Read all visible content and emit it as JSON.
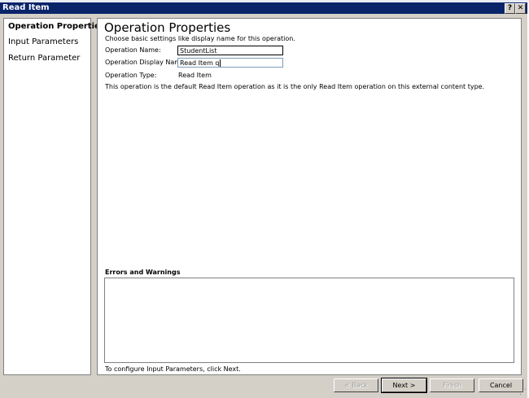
{
  "window": {
    "title": "Read Item",
    "help_glyph": "?",
    "close_glyph": "✕"
  },
  "nav": {
    "items": [
      {
        "label": "Operation Properties",
        "active": true
      },
      {
        "label": "Input Parameters",
        "active": false
      },
      {
        "label": "Return Parameter",
        "active": false
      }
    ]
  },
  "content": {
    "heading": "Operation Properties",
    "subtitle": "Choose basic settings like display name for this operation.",
    "operation_name_label": "Operation Name:",
    "operation_name_value": "StudentList",
    "display_name_label": "Operation Display Name:",
    "display_name_value": "Read Item q",
    "operation_type_label": "Operation Type:",
    "operation_type_value": "Read Item",
    "description": "This operation is the default Read Item operation as it is the only Read Item operation on this external content type.",
    "errors_heading": "Errors and Warnings",
    "footer_hint": "To configure Input Parameters, click Next."
  },
  "buttons": {
    "back": "< Back",
    "next": "Next >",
    "finish": "Finish",
    "cancel": "Cancel"
  }
}
